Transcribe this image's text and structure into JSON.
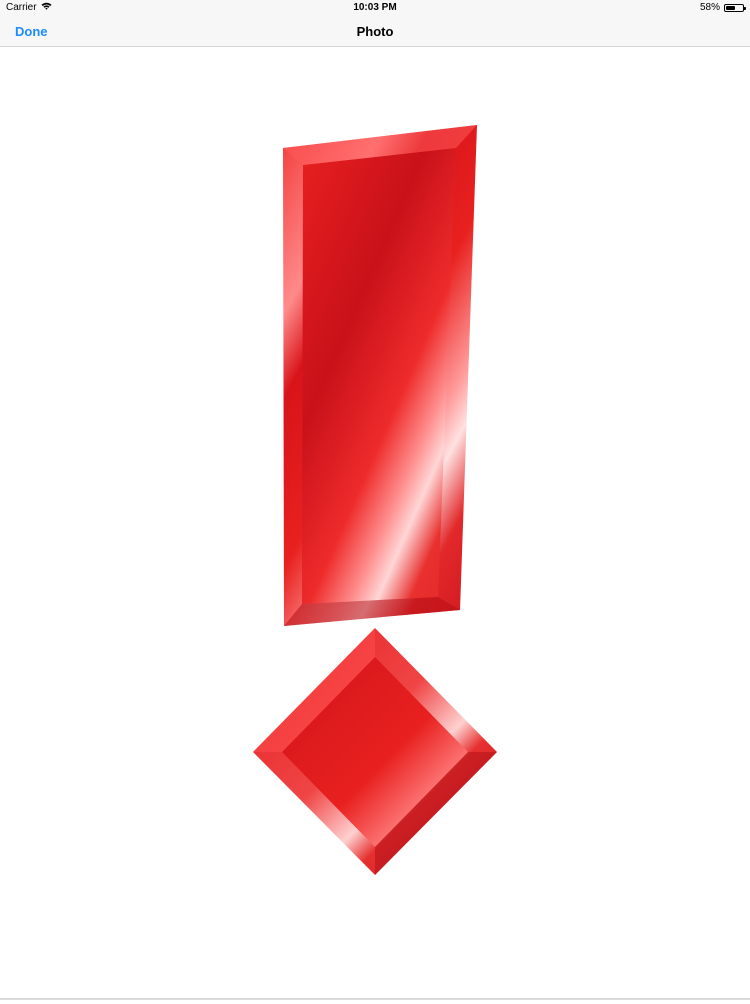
{
  "status_bar": {
    "carrier": "Carrier",
    "time": "10:03 PM",
    "battery_percent_label": "58%",
    "battery_level": 0.58
  },
  "nav_bar": {
    "done_label": "Done",
    "title": "Photo"
  },
  "photo": {
    "subject_icon": "exclamation-mark-icon",
    "colors": {
      "red_main": "#e21b1f",
      "red_dark": "#b80f14",
      "red_light": "#ff6b6b",
      "highlight": "#ffd9d9"
    }
  },
  "colors": {
    "accent": "#1a8cff",
    "bar_background": "#f7f7f8"
  }
}
